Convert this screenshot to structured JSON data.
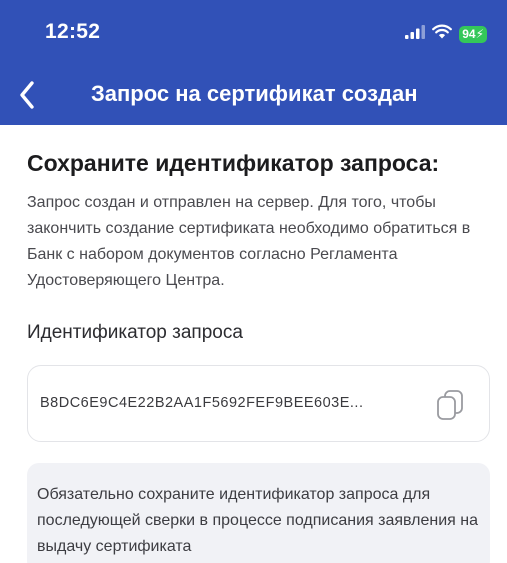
{
  "status_bar": {
    "time": "12:52",
    "battery": "94",
    "battery_color": "#34c759"
  },
  "nav": {
    "title": "Запрос на сертификат создан",
    "back_icon": "chevron-left-icon",
    "background_color": "#3151b7"
  },
  "main": {
    "section_title": "Сохраните идентификатор запроса:",
    "description": "Запрос создан и отправлен на сервер. Для того, чтобы закончить создание сертификата необходимо обратиться в Банк с набором документов согласно Регламента Удостоверяющего Центра.",
    "field_label": "Идентификатор запроса",
    "request_id": "B8DC6E9C4E22B2AA1F5692FEF9BEE603E...",
    "copy_icon": "copy-icon",
    "notice": "Обязательно сохраните идентификатор запроса для последующей сверки в процессе подписания заявления на выдачу сертификата"
  }
}
